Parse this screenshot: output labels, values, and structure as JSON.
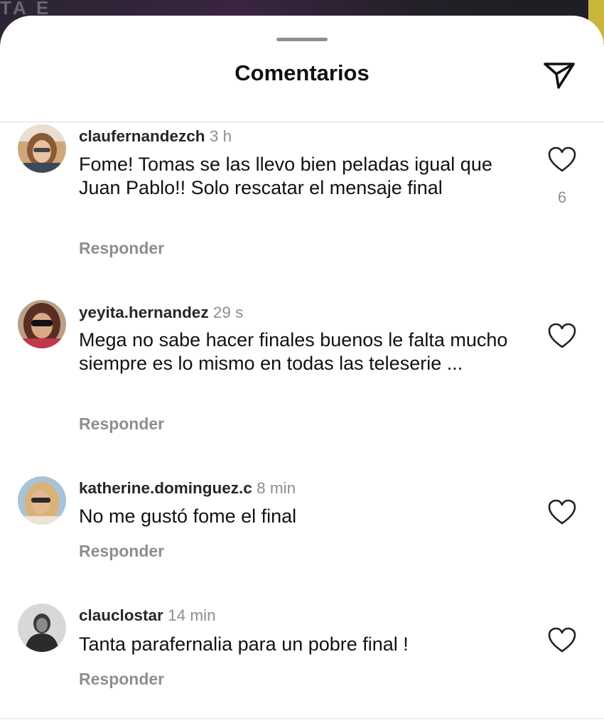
{
  "background": {
    "banner_text": "TA E",
    "accent_color": "#c9b53a"
  },
  "header": {
    "title": "Comentarios",
    "send_icon": "send-paper-plane-icon"
  },
  "colors": {
    "text": "#111111",
    "muted": "#8e8e8e",
    "divider": "#dbdbdb"
  },
  "comments": [
    {
      "username": "claufernandezch",
      "time": "3 h",
      "text": "Fome! Tomas se las llevo bien peladas igual que Juan Pablo!! Solo rescatar el mensaje final",
      "reply_label": "Responder",
      "like_count": "6",
      "like_icon": "heart-outline-icon"
    },
    {
      "username": "yeyita.hernandez",
      "time": "29 s",
      "text": "Mega no sabe hacer finales buenos  le falta mucho siempre es lo mismo  en todas las teleserie ...",
      "reply_label": "Responder",
      "like_icon": "heart-outline-icon"
    },
    {
      "username": "katherine.dominguez.c",
      "time": "8 min",
      "text": "No me gustó fome el final",
      "reply_label": "Responder",
      "like_icon": "heart-outline-icon"
    },
    {
      "username": "clauclostar",
      "time": "14 min",
      "text": "Tanta parafernalia para un pobre final !",
      "reply_label": "Responder",
      "like_icon": "heart-outline-icon"
    }
  ]
}
